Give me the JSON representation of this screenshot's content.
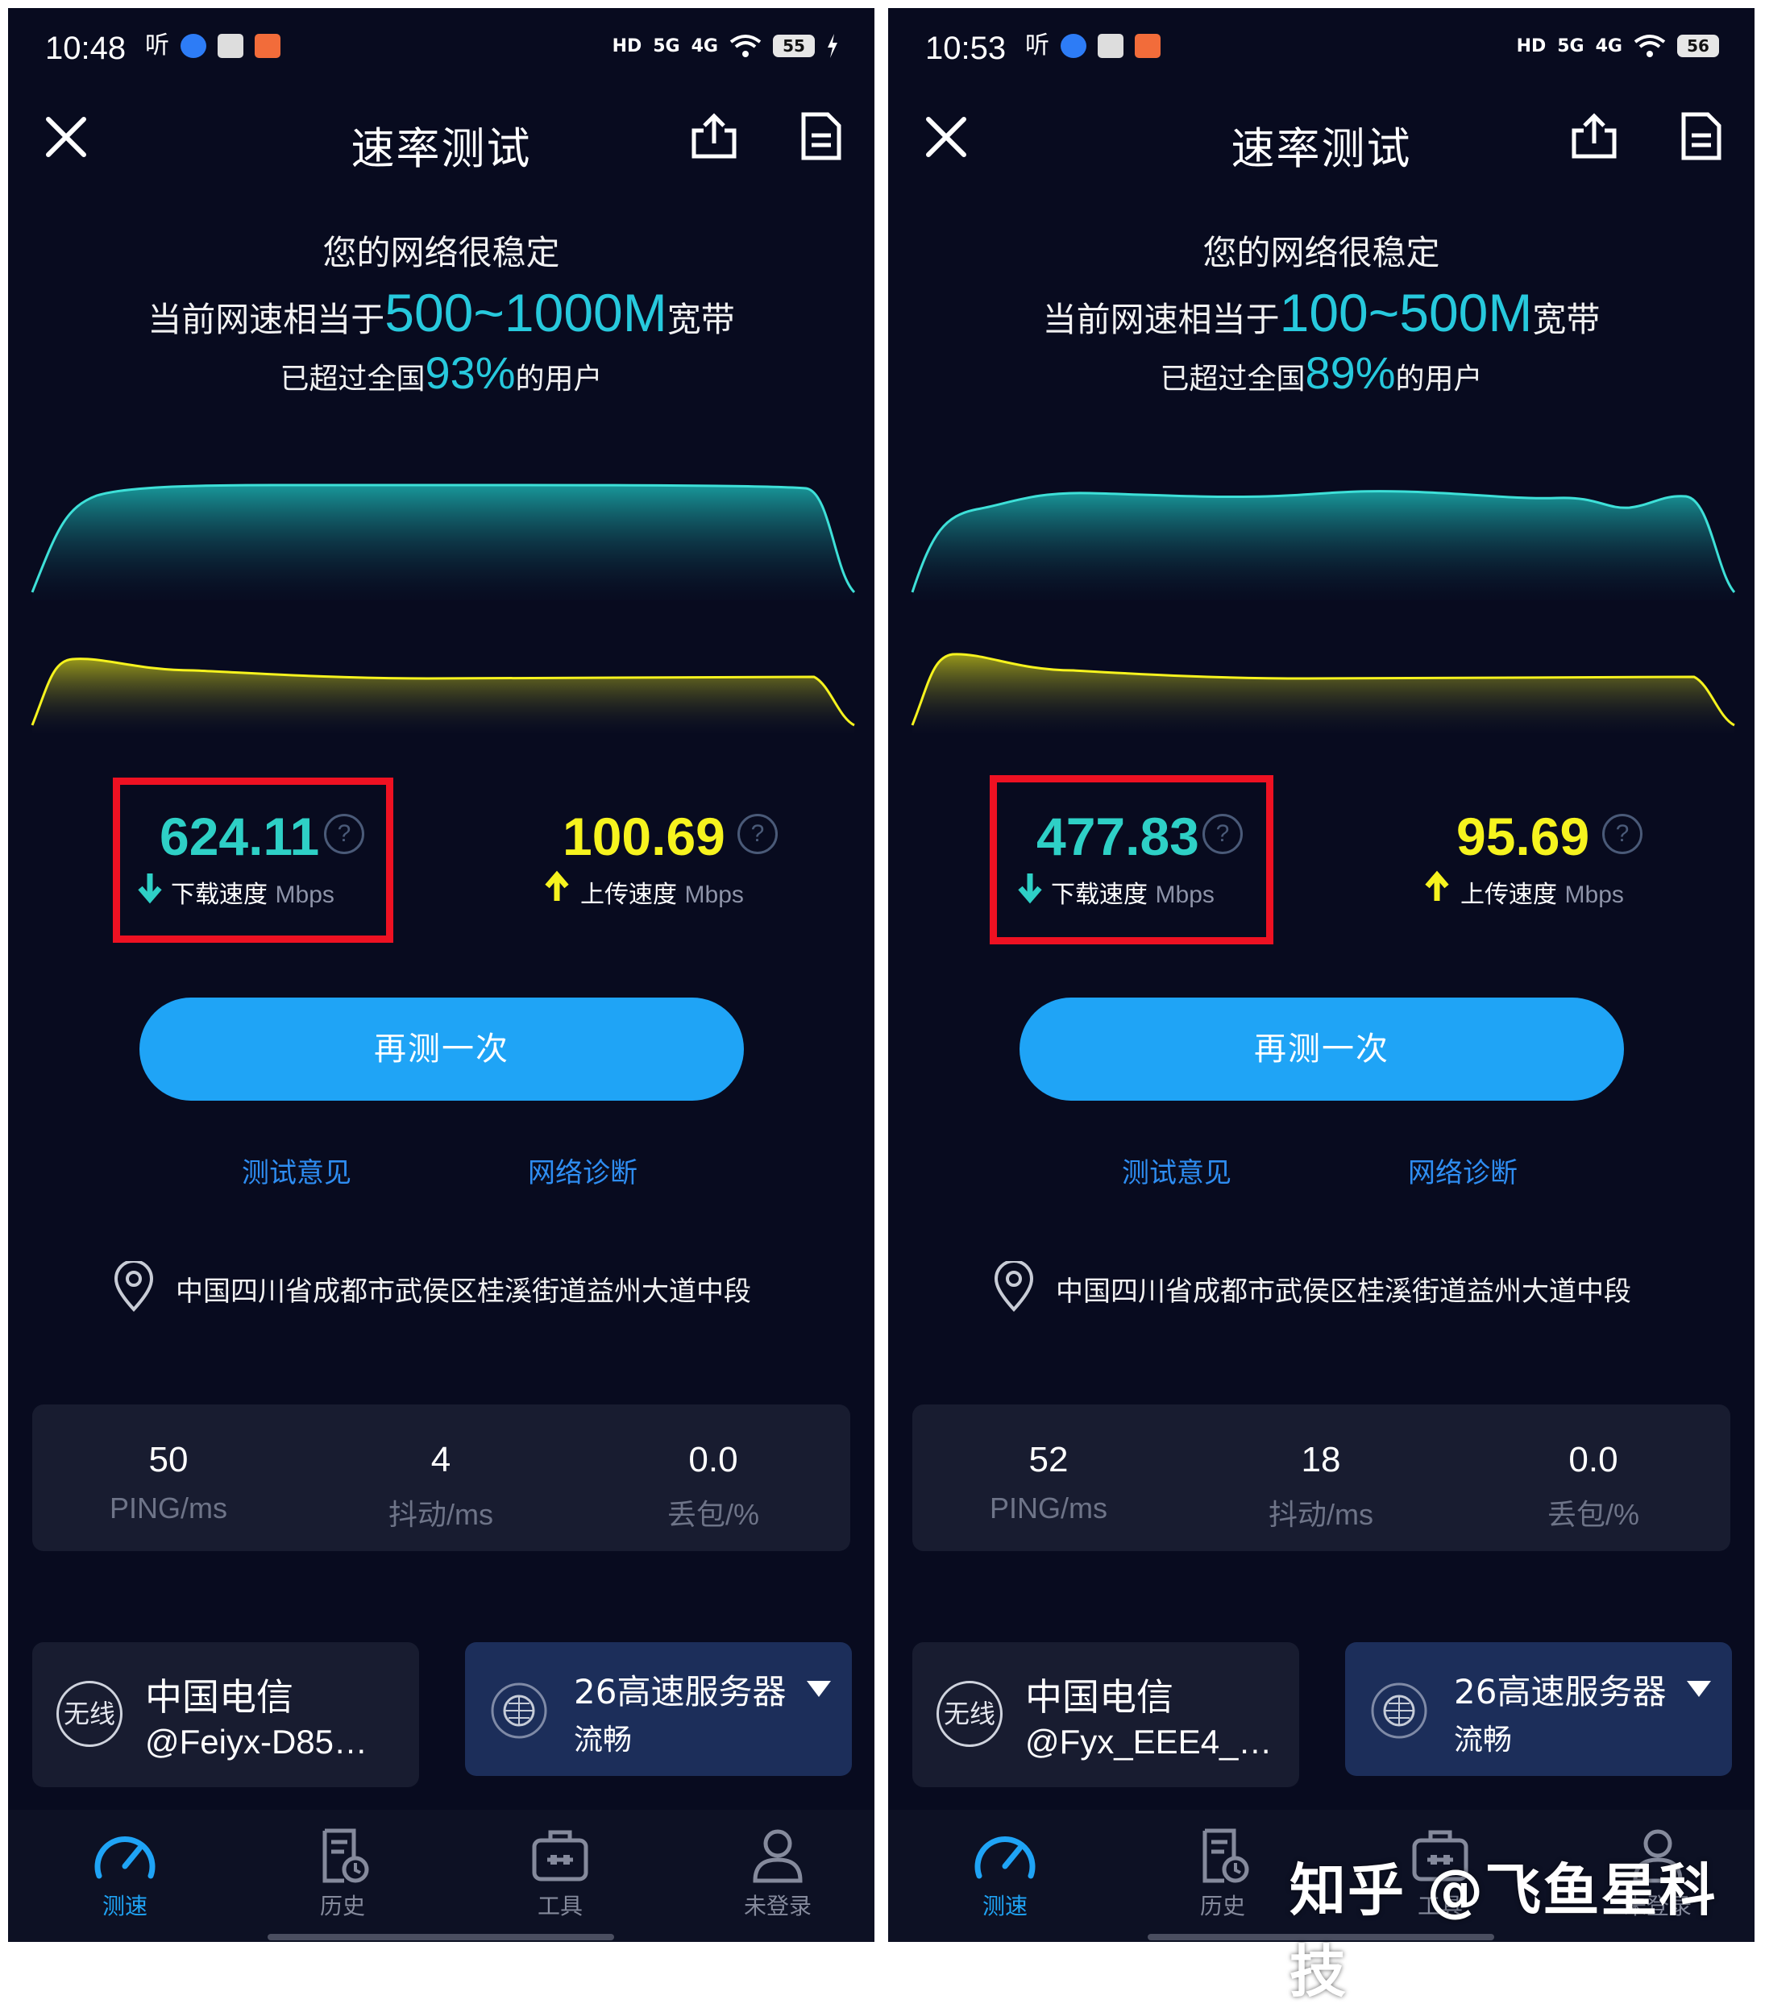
{
  "watermark": "知乎 @飞鱼星科技",
  "colors": {
    "accent": "#27c9dd",
    "download": "#2ed0c6",
    "upload": "#f6f31e",
    "button": "#1fa4f6",
    "highlight": "#ee1122"
  },
  "screens": [
    {
      "status": {
        "time": "10:48",
        "app_glyph": "听",
        "battery": "55",
        "net1": "5G",
        "net2": "4G",
        "hd": "HD"
      },
      "title": "速率测试",
      "headline": "您的网络很稳定",
      "speed_prefix": "当前网速相当于",
      "speed_range": "500~1000M",
      "speed_suffix": "宽带",
      "pct_prefix": "已超过全国",
      "pct_value": "93%",
      "pct_suffix": "的用户",
      "download": {
        "value": "624.11",
        "label": "下载速度",
        "unit": "Mbps"
      },
      "upload": {
        "value": "100.69",
        "label": "上传速度",
        "unit": "Mbps"
      },
      "retest_label": "再测一次",
      "feedback_label": "测试意见",
      "diagnose_label": "网络诊断",
      "location": "中国四川省成都市武侯区桂溪街道益州大道中段",
      "stats": [
        {
          "value": "50",
          "label": "PING/ms"
        },
        {
          "value": "4",
          "label": "抖动/ms"
        },
        {
          "value": "0.0",
          "label": "丢包/%"
        }
      ],
      "carrier": {
        "badge": "无线",
        "name": "中国电信",
        "ssid": "@Feiyx-D85…"
      },
      "server": {
        "name": "26高速服务器",
        "state": "流畅"
      },
      "tabs": [
        {
          "label": "测速",
          "icon": "speedometer-icon",
          "active": true
        },
        {
          "label": "历史",
          "icon": "history-icon",
          "active": false
        },
        {
          "label": "工具",
          "icon": "toolbox-icon",
          "active": false
        },
        {
          "label": "未登录",
          "icon": "user-icon",
          "active": false
        }
      ]
    },
    {
      "status": {
        "time": "10:53",
        "app_glyph": "听",
        "battery": "56",
        "net1": "5G",
        "net2": "4G",
        "hd": "HD"
      },
      "title": "速率测试",
      "headline": "您的网络很稳定",
      "speed_prefix": "当前网速相当于",
      "speed_range": "100~500M",
      "speed_suffix": "宽带",
      "pct_prefix": "已超过全国",
      "pct_value": "89%",
      "pct_suffix": "的用户",
      "download": {
        "value": "477.83",
        "label": "下载速度",
        "unit": "Mbps"
      },
      "upload": {
        "value": "95.69",
        "label": "上传速度",
        "unit": "Mbps"
      },
      "retest_label": "再测一次",
      "feedback_label": "测试意见",
      "diagnose_label": "网络诊断",
      "location": "中国四川省成都市武侯区桂溪街道益州大道中段",
      "stats": [
        {
          "value": "52",
          "label": "PING/ms"
        },
        {
          "value": "18",
          "label": "抖动/ms"
        },
        {
          "value": "0.0",
          "label": "丢包/%"
        }
      ],
      "carrier": {
        "badge": "无线",
        "name": "中国电信",
        "ssid": "@Fyx_EEE4_…"
      },
      "server": {
        "name": "26高速服务器",
        "state": "流畅"
      },
      "tabs": [
        {
          "label": "测速",
          "icon": "speedometer-icon",
          "active": true
        },
        {
          "label": "历史",
          "icon": "history-icon",
          "active": false
        },
        {
          "label": "工具",
          "icon": "toolbox-icon",
          "active": false
        },
        {
          "label": "未登录",
          "icon": "user-icon",
          "active": false
        }
      ]
    }
  ]
}
